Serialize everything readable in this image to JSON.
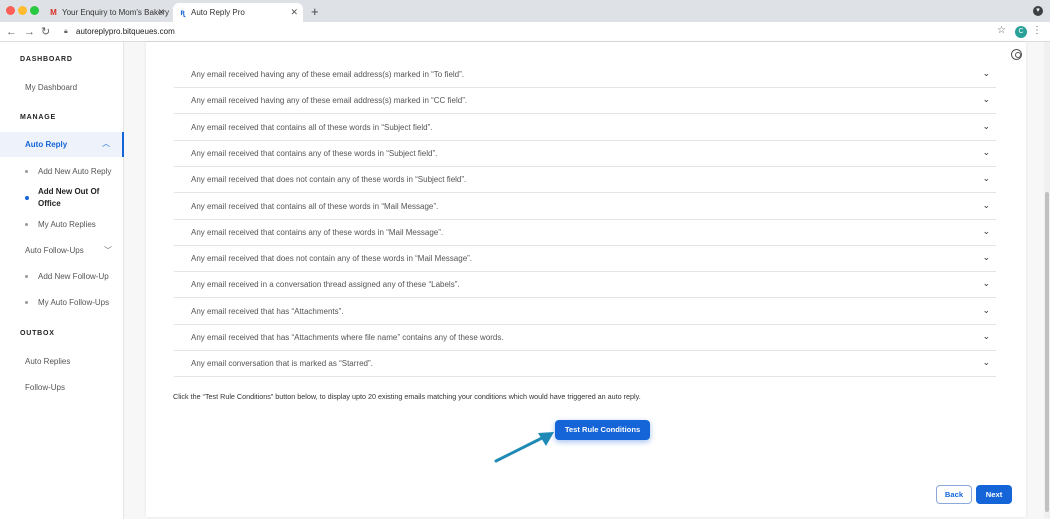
{
  "browser": {
    "tabs": [
      {
        "title": "Your Enquiry to Mom's Bakery",
        "favicon": "gmail-icon",
        "active": false
      },
      {
        "title": "Auto Reply Pro",
        "favicon": "app-icon",
        "active": true
      }
    ],
    "url": "autoreplypro.bitqueues.com",
    "profile_initial": "C"
  },
  "sidebar": {
    "dashboard_heading": "DASHBOARD",
    "my_dashboard": "My Dashboard",
    "manage_heading": "MANAGE",
    "auto_reply": "Auto Reply",
    "auto_reply_items": [
      "Add New Auto Reply",
      "Add New Out Of Office",
      "My Auto Replies"
    ],
    "auto_followups": "Auto Follow-Ups",
    "followup_items": [
      "Add New Follow-Up",
      "My Auto Follow-Ups"
    ],
    "outbox_heading": "OUTBOX",
    "outbox_items": [
      "Auto Replies",
      "Follow-Ups"
    ]
  },
  "conditions": [
    "Any email received having any of these email address(s) marked in “To field”.",
    "Any email received having any of these email address(s) marked in “CC field”.",
    "Any email received that contains all of these words in “Subject field”.",
    "Any email received that contains any of these words in “Subject field”.",
    "Any email received that does not contain any of these words in “Subject field”.",
    "Any email received that contains all of these words in “Mail Message”.",
    "Any email received that contains any of these words in “Mail Message”.",
    "Any email received that does not contain any of these words in “Mail Message”.",
    "Any email received in a conversation thread assigned any of these “Labels”.",
    "Any email received that has “Attachments”.",
    "Any email received that has “Attachments where file name” contains any of these words.",
    "Any email conversation that is marked as “Starred”."
  ],
  "info_text": "Click the “Test Rule Conditions” button below, to display upto 20 existing emails matching your conditions which would have triggered an auto reply.",
  "buttons": {
    "test": "Test Rule Conditions",
    "back": "Back",
    "next": "Next"
  },
  "colors": {
    "accent": "#1565d8",
    "arrow": "#1f8ab5"
  }
}
